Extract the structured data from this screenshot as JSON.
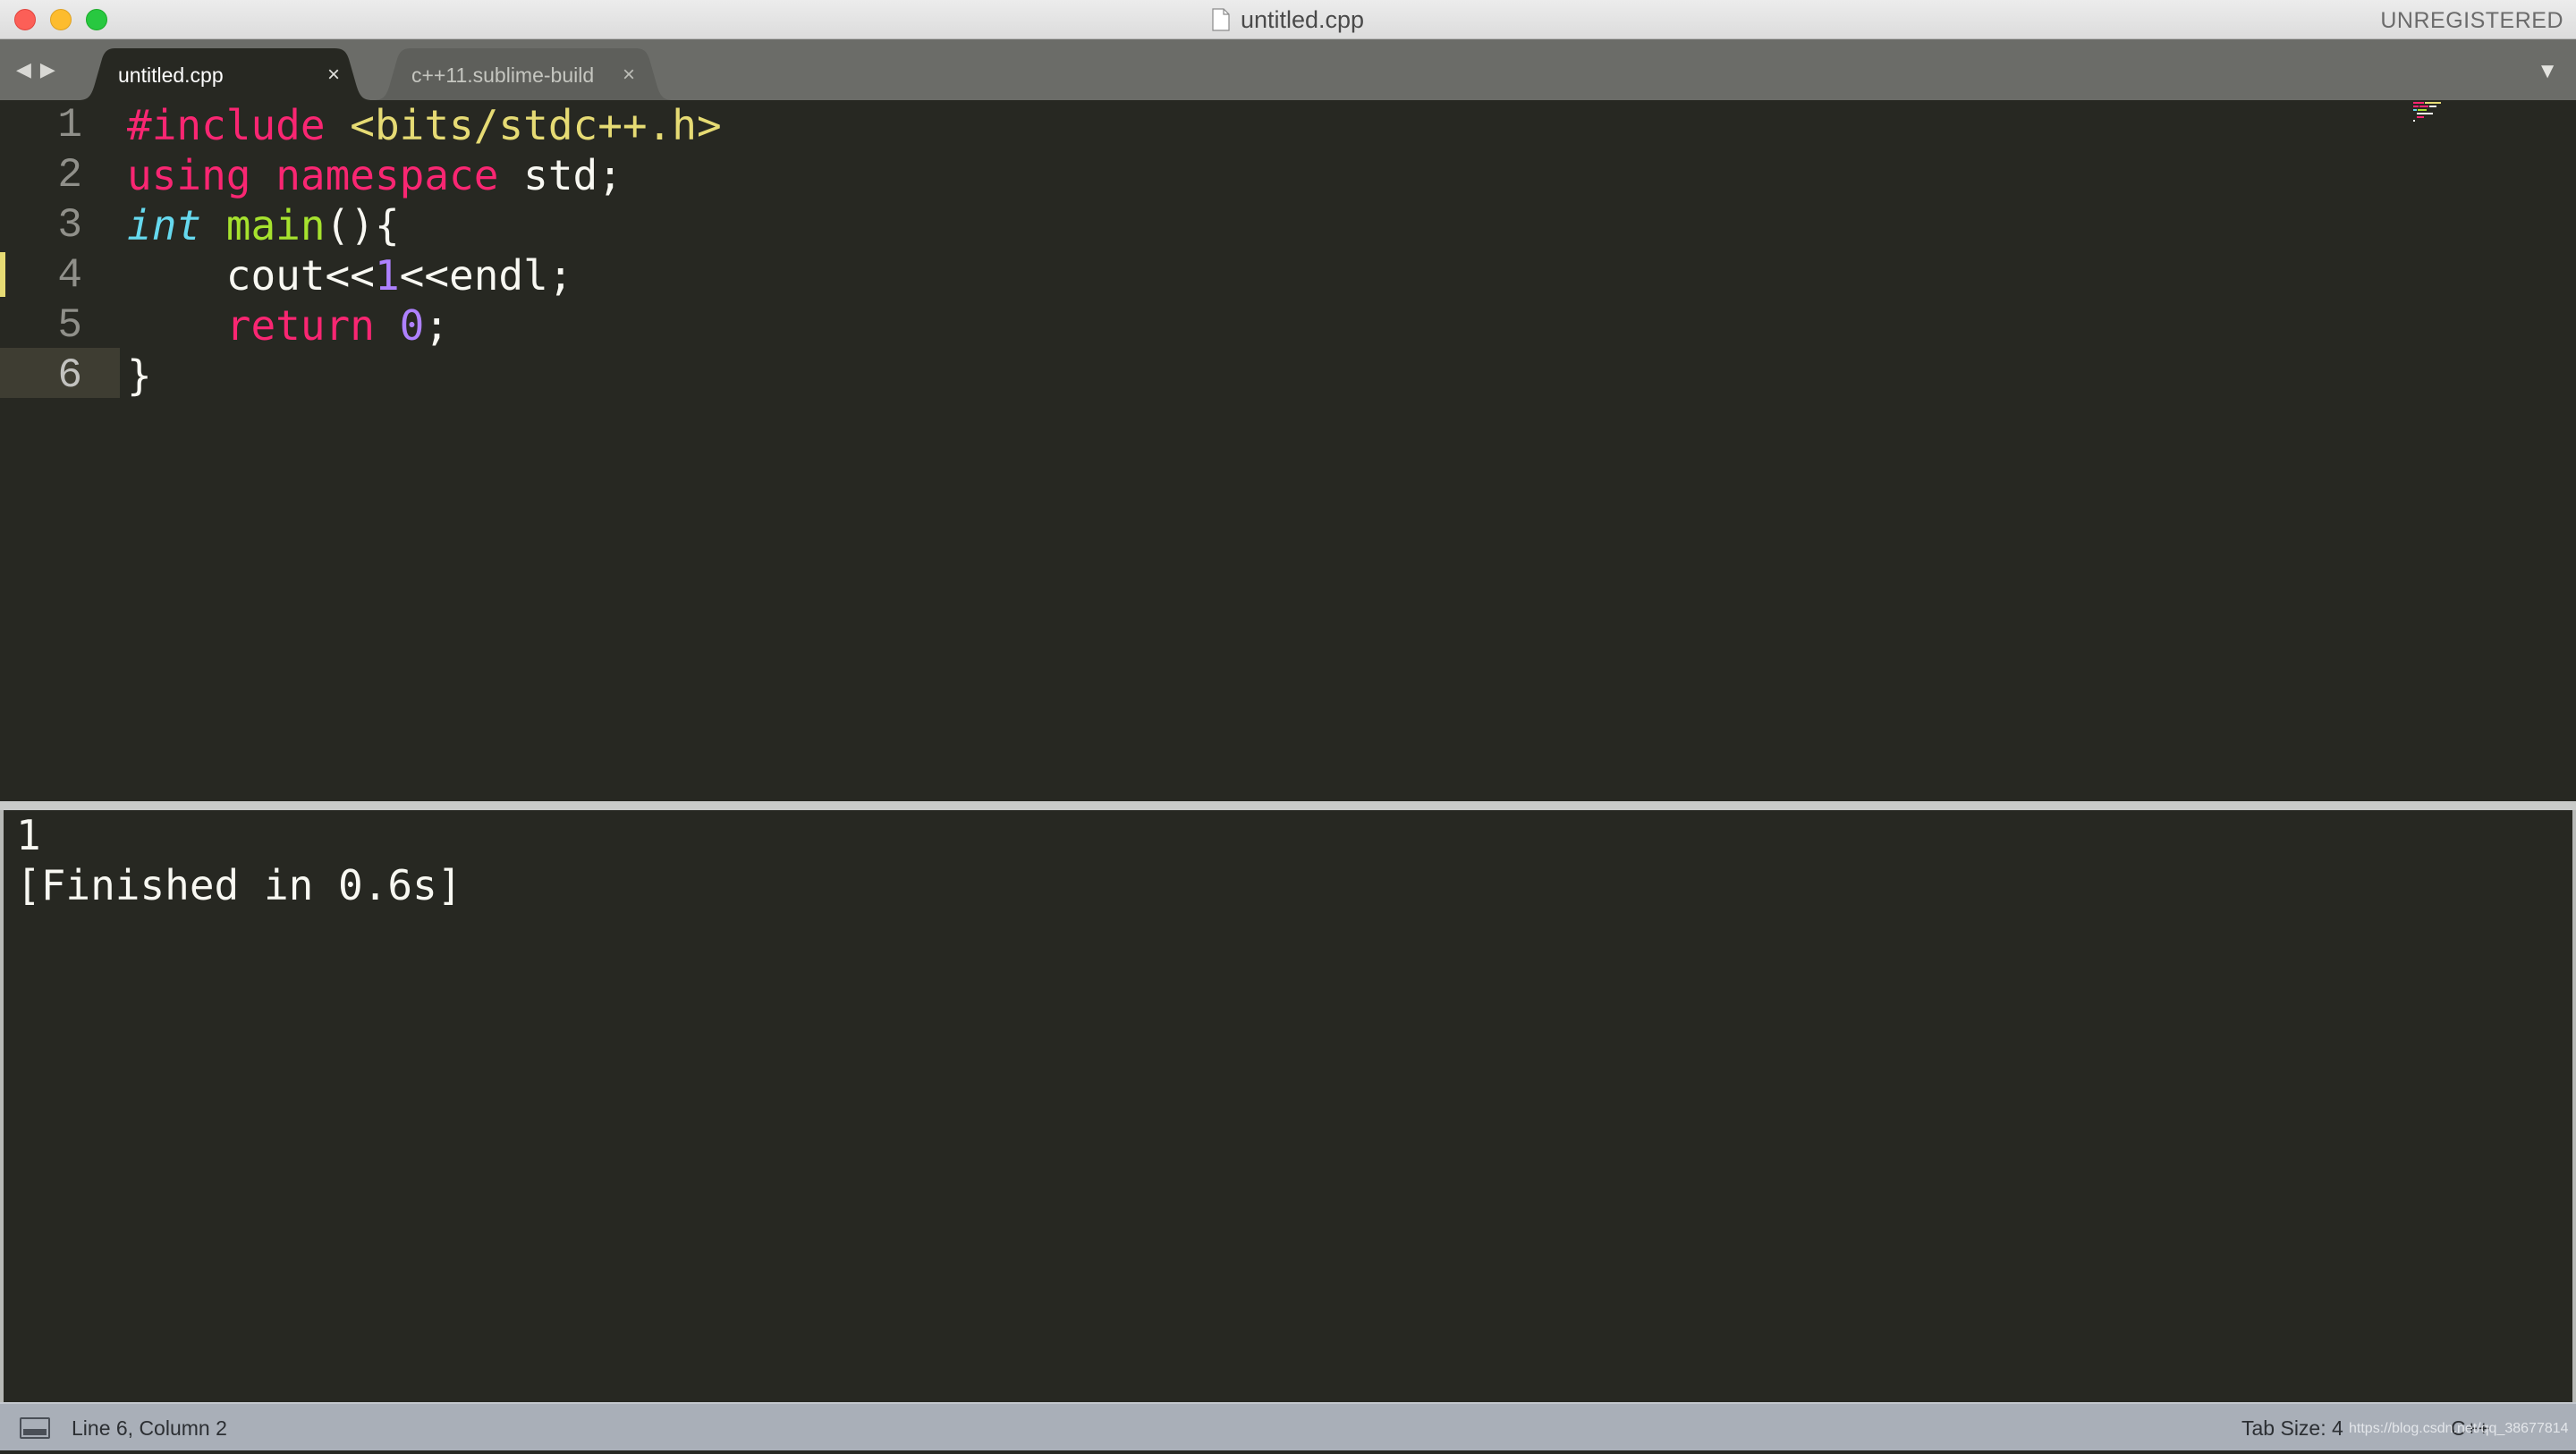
{
  "window": {
    "title": "untitled.cpp",
    "registration": "UNREGISTERED"
  },
  "tabs": [
    {
      "label": "untitled.cpp",
      "active": true
    },
    {
      "label": "c++11.sublime-build",
      "active": false
    }
  ],
  "icons": {
    "close_tab": "×",
    "nav_back": "◀",
    "nav_forward": "▶",
    "tabs_dropdown": "▼"
  },
  "editor": {
    "line_numbers": [
      "1",
      "2",
      "3",
      "4",
      "5",
      "6"
    ],
    "current_line": 6,
    "modified_line": 4,
    "lines": [
      [
        {
          "t": "#include",
          "c": "t-kw"
        },
        {
          "t": " ",
          "c": "t-plain"
        },
        {
          "t": "<bits/stdc++.h>",
          "c": "t-str"
        }
      ],
      [
        {
          "t": "using",
          "c": "t-kw"
        },
        {
          "t": " ",
          "c": "t-plain"
        },
        {
          "t": "namespace",
          "c": "t-kw"
        },
        {
          "t": " std;",
          "c": "t-plain"
        }
      ],
      [
        {
          "t": "int",
          "c": "t-type"
        },
        {
          "t": " ",
          "c": "t-plain"
        },
        {
          "t": "main",
          "c": "t-fn"
        },
        {
          "t": "(){",
          "c": "t-plain"
        }
      ],
      [
        {
          "t": "    cout<<",
          "c": "t-plain"
        },
        {
          "t": "1",
          "c": "t-num"
        },
        {
          "t": "<<endl;",
          "c": "t-plain"
        }
      ],
      [
        {
          "t": "    ",
          "c": "t-plain"
        },
        {
          "t": "return",
          "c": "t-kw"
        },
        {
          "t": " ",
          "c": "t-plain"
        },
        {
          "t": "0",
          "c": "t-num"
        },
        {
          "t": ";",
          "c": "t-plain"
        }
      ],
      [
        {
          "t": "}",
          "c": "t-plain"
        }
      ]
    ]
  },
  "output": {
    "lines": [
      "1",
      "[Finished in 0.6s]"
    ]
  },
  "statusbar": {
    "position": "Line 6, Column 2",
    "tab_size": "Tab Size: 4",
    "syntax": "C++",
    "watermark": "https://blog.csdn.net/qq_38677814"
  },
  "colors": {
    "background": "#272822",
    "keyword": "#f92672",
    "string": "#e6db74",
    "type": "#66d9ef",
    "function": "#a6e22e",
    "number": "#ae81ff",
    "foreground": "#f8f8f2"
  }
}
